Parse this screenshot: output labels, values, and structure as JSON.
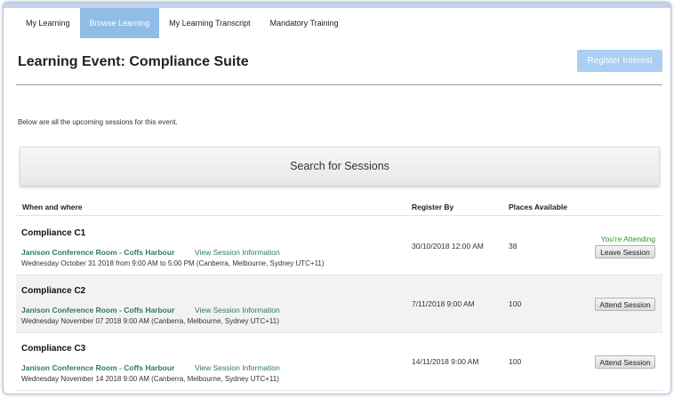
{
  "tabs": [
    {
      "label": "My Learning"
    },
    {
      "label": "Browse Learning",
      "active": true
    },
    {
      "label": "My Learning Transcript"
    },
    {
      "label": "Mandatory Training"
    }
  ],
  "page": {
    "title": "Learning Event: Compliance Suite",
    "register_button": "Register Interest",
    "intro": "Below are all the upcoming sessions for this event.",
    "search_button": "Search for Sessions"
  },
  "table": {
    "headers": {
      "when_where": "When and where",
      "register_by": "Register By",
      "places": "Places Available"
    },
    "rows": [
      {
        "title": "Compliance C1",
        "location": "Janison Conference Room - Coffs Harbour",
        "link": "View Session Information",
        "time": "Wednesday October 31 2018 from 9:00 AM to 5:00 PM (Canberra, Melbourne, Sydney UTC+11)",
        "register_by": "30/10/2018 12:00 AM",
        "places": "38",
        "status": "You're Attending",
        "action": "Leave Session"
      },
      {
        "title": "Compliance C2",
        "location": "Janison Conference Room - Coffs Harbour",
        "link": "View Session Information",
        "time": "Wednesday November 07 2018 9:00 AM (Canberra, Melbourne, Sydney UTC+11)",
        "register_by": "7/11/2018 9:00 AM",
        "places": "100",
        "status": "",
        "action": "Attend Session"
      },
      {
        "title": "Compliance C3",
        "location": "Janison Conference Room - Coffs Harbour",
        "link": "View Session Information",
        "time": "Wednesday November 14 2018 9:00 AM (Canberra, Melbourne, Sydney UTC+11)",
        "register_by": "14/11/2018 9:00 AM",
        "places": "100",
        "status": "",
        "action": "Attend Session"
      }
    ]
  },
  "colors": {
    "accent_tab": "#8fbde8",
    "register_button": "#a9cff3",
    "link_green": "#2f7a5a",
    "status_green": "#2a9a2a"
  }
}
